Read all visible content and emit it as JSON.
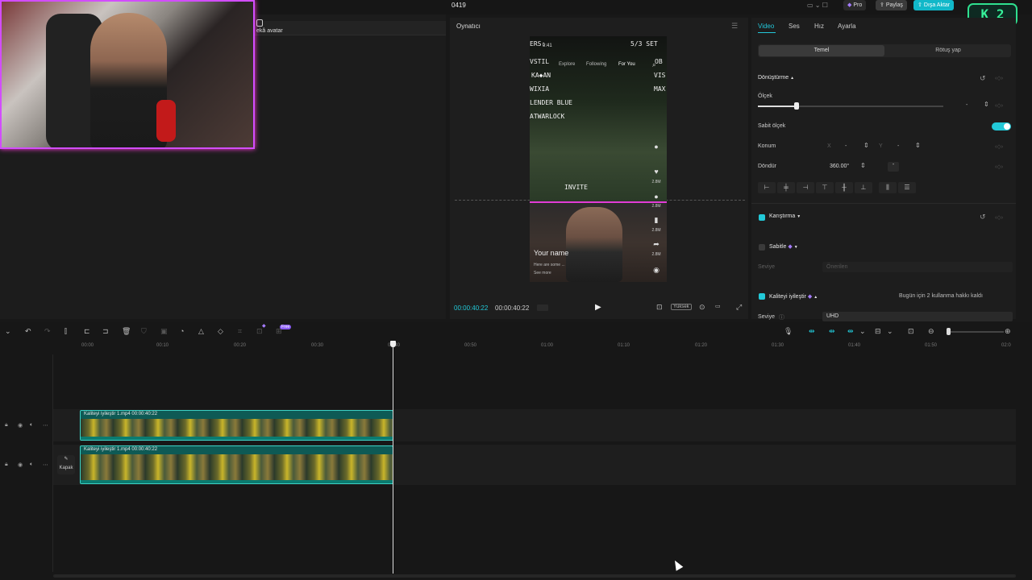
{
  "window": {
    "project_title": "0419"
  },
  "topbar": {
    "pro_label": "Pro",
    "share_label": "Paylaş",
    "export_label": "Dışa Aktar"
  },
  "overlay_badge": {
    "text": "K 2",
    "color": "#37f29a"
  },
  "media": {
    "ai_avatar_label": "ekâ avatar"
  },
  "player": {
    "title": "Oynatıcı",
    "time_current": "00:00:40:22",
    "time_total": "00:00:40:22",
    "quality_label": "Yüksek",
    "preview": {
      "top_left": "ERS:",
      "top_time": "9:41",
      "top_right": "5/3 SET",
      "tabs": [
        "Explore",
        "Following",
        "For You"
      ],
      "left_list": [
        "VSTIL",
        "KA◆AN",
        "WIXIA",
        "LENDER BLUE",
        "ATWARLOCK"
      ],
      "right_list": [
        "OB",
        "VIS",
        "MAX"
      ],
      "invite": "INVITE",
      "your_name": "Your name",
      "desc": "Here are some ...",
      "see_more": "See more",
      "counts": [
        "2.8M",
        "2.8M",
        "2.8M",
        "2.8M"
      ]
    }
  },
  "properties": {
    "tabs": [
      "Video",
      "Ses",
      "Hız",
      "Ayarla"
    ],
    "subtabs": [
      "Temel",
      "Rötuş yap"
    ],
    "transform": {
      "title": "Dönüştürme",
      "scale_label": "Ölçek",
      "scale_value": "-",
      "scale_level": 0.2,
      "uniform_scale_label": "Sabit ölçek",
      "uniform_scale_on": true,
      "position_label": "Konum",
      "x_label": "X",
      "x_value": "-",
      "y_label": "Y",
      "y_value": "-",
      "rotate_label": "Döndür",
      "rotate_value": "360.00°",
      "rotate_dash": "-"
    },
    "blend": {
      "title": "Karıştırma",
      "checked": true
    },
    "stabilize": {
      "title": "Sabitle",
      "checked": false,
      "level_label": "Seviye",
      "level_value": "Önerilen"
    },
    "enhance": {
      "title": "Kaliteyi iyileştir",
      "checked": true,
      "note": "Bugün için 2 kullanma hakkı kaldı",
      "level_label": "Seviye",
      "level_value": "UHD"
    }
  },
  "timeline": {
    "free_badge": "Free",
    "ruler": [
      "00:00",
      "00:10",
      "00:20",
      "00:30",
      "00:40",
      "00:50",
      "01:00",
      "01:10",
      "01:20",
      "01:30",
      "01:40",
      "01:50",
      "02:0"
    ],
    "clips": [
      {
        "label": "Kaliteyi iyileştir   1.mp4   00:00:40:22"
      },
      {
        "label": "Kaliteyi iyileştir   1.mp4   00:00:40:22"
      }
    ],
    "cover_label": "Kapak"
  },
  "colors": {
    "accent": "#22c9d8",
    "export": "#11b8c9",
    "clip": "#0e5a55",
    "clip_border": "#3bd1c4",
    "webcam_border": "#d24dff"
  }
}
